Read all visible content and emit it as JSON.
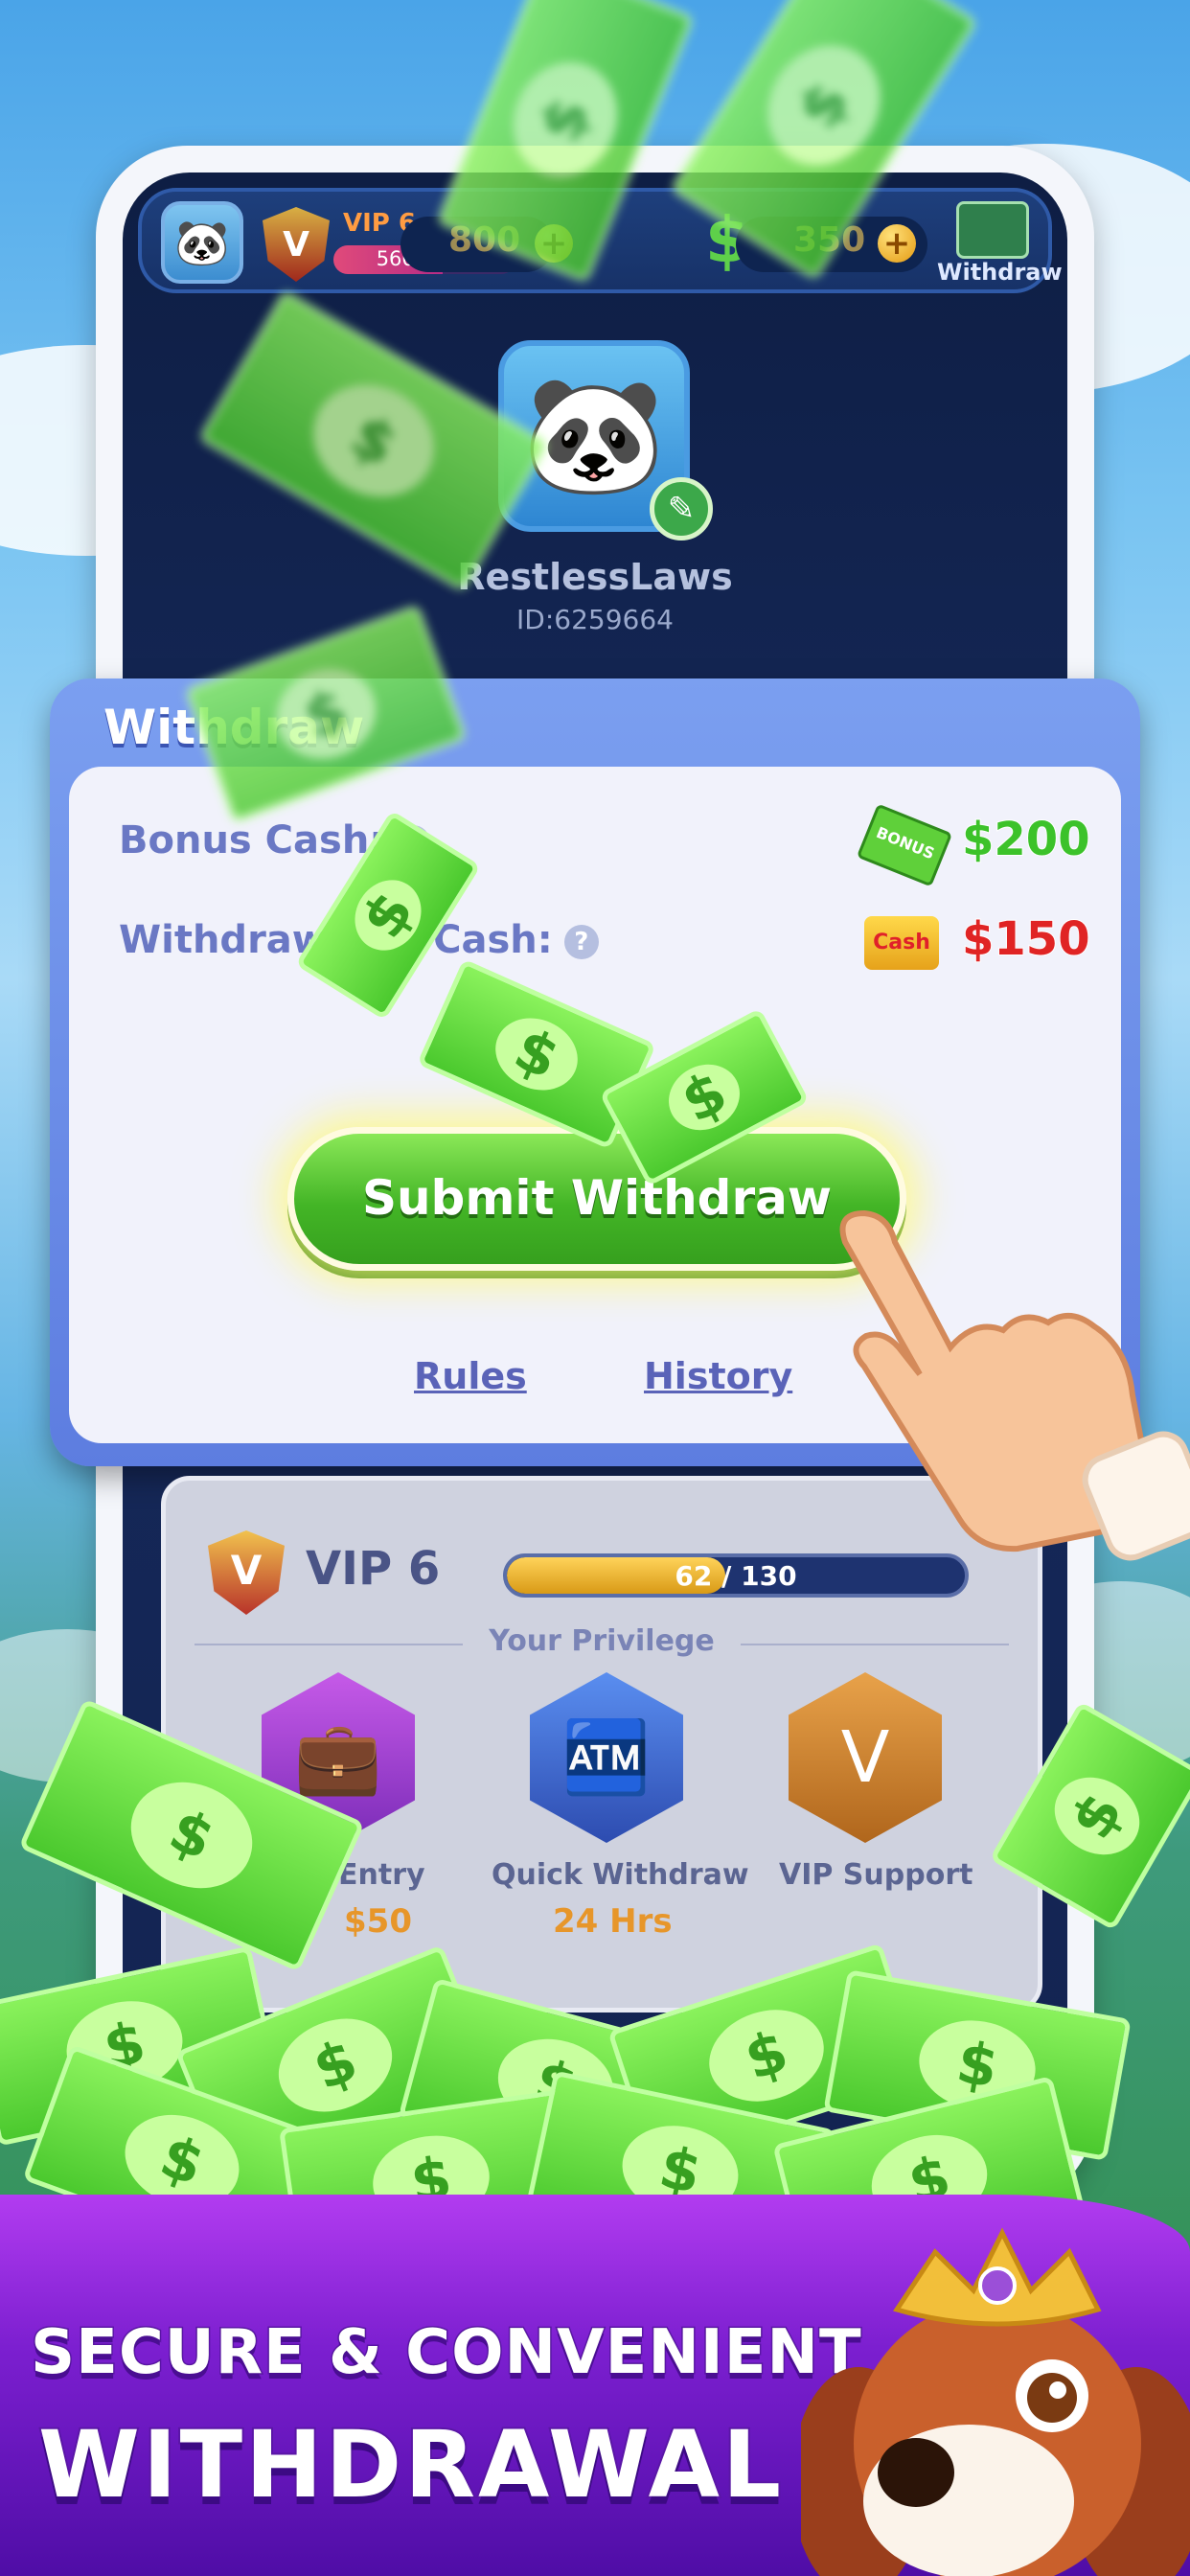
{
  "top_bar": {
    "vip_level": "VIP 6",
    "vip_progress": "560/1000",
    "gems": "800",
    "cash": "350",
    "withdraw_label": "Withdraw"
  },
  "profile": {
    "username": "RestlessLaws",
    "user_id": "ID:6259664"
  },
  "withdraw_card": {
    "title": "Withdraw",
    "bonus_label": "Bonus Cash:",
    "bonus_amount": "$200",
    "bonus_icon_text": "BONUS",
    "withdrawable_label": "Withdrawable Cash:",
    "withdrawable_amount": "$150",
    "cash_icon_text": "Cash",
    "submit_label": "Submit Withdraw",
    "rules_link": "Rules",
    "history_link": "History"
  },
  "vip_card": {
    "level": "VIP 6",
    "progress_text": "62 / 130",
    "progress_fraction": 0.477,
    "privilege_title": "Your Privilege",
    "privileges": [
      {
        "name": "Entry",
        "sub": "$50"
      },
      {
        "name": "Quick Withdraw",
        "sub": "24 Hrs"
      },
      {
        "name": "VIP Support",
        "sub": ""
      }
    ]
  },
  "banner": {
    "line1": "SECURE & CONVENIENT",
    "line2": "WITHDRAWAL"
  },
  "colors": {
    "bonus_green": "#3cc22a",
    "cash_red": "#e02424",
    "submit_green": "#43b526",
    "banner_purple": "#7c1fd0"
  },
  "icons": {
    "bill_symbol": "$",
    "help": "?",
    "plus": "+",
    "edit": "✎",
    "panda": "🐼",
    "vip": "V"
  }
}
